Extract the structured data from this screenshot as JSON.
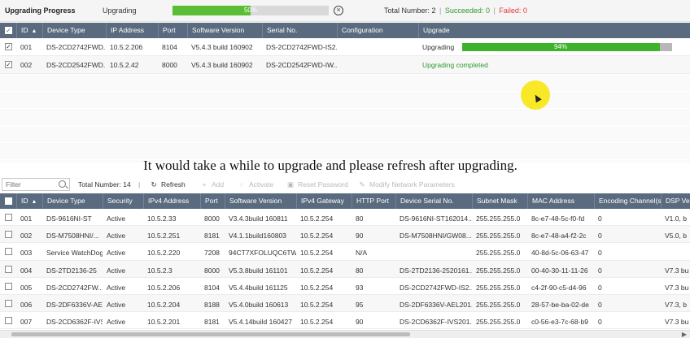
{
  "upgrade_progress": {
    "title": "Upgrading Progress",
    "status": "Upgrading",
    "percent": 50,
    "percent_label": "50%",
    "total_label": "Total Number: 2",
    "succeeded_label": "Succeeded: 0",
    "failed_label": "Failed: 0",
    "cancel_icon": "close-circle-icon"
  },
  "upgrade_table": {
    "headers": [
      "ID",
      "Device Type",
      "IP Address",
      "Port",
      "Software Version",
      "Serial No.",
      "Configuration",
      "Upgrade"
    ],
    "rows": [
      {
        "id": "001",
        "device_type": "DS-2CD2742FWD...",
        "ip": "10.5.2.206",
        "port": "8104",
        "software": "V5.4.3 build 160902",
        "serial": "DS-2CD2742FWD-IS2...",
        "configuration": "",
        "upgrade_status": "Upgrading",
        "upgrade_percent": 94,
        "upgrade_label": "94%"
      },
      {
        "id": "002",
        "device_type": "DS-2CD2542FWD...",
        "ip": "10.5.2.42",
        "port": "8000",
        "software": "V5.4.3 build 160902",
        "serial": "DS-2CD2542FWD-IW...",
        "configuration": "",
        "upgrade_status": "Upgrading completed"
      }
    ]
  },
  "notice": "It would take a while to upgrade and please refresh after upgrading.",
  "toolbar": {
    "filter_placeholder": "Filter",
    "total": "Total Number: 14",
    "refresh": "Refresh",
    "add": "Add",
    "activate": "Activate",
    "reset_password": "Reset Password",
    "modify_network": "Modify Network Parameters"
  },
  "device_table": {
    "headers": [
      "ID",
      "Device Type",
      "Security",
      "IPv4 Address",
      "Port",
      "Software Version",
      "IPv4 Gateway",
      "HTTP Port",
      "Device Serial No.",
      "Subnet Mask",
      "MAC Address",
      "Encoding Channel(s)",
      "DSP Ve"
    ],
    "rows": [
      {
        "id": "001",
        "device_type": "DS-9616NI-ST",
        "security": "Active",
        "ipv4": "10.5.2.33",
        "port": "8000",
        "software": "V3.4.3build 160811",
        "gateway": "10.5.2.254",
        "http_port": "80",
        "serial": "DS-9616NI-ST162014...",
        "subnet": "255.255.255.0",
        "mac": "8c-e7-48-5c-f0-fd",
        "channels": "0",
        "dsp": "V1.0, b"
      },
      {
        "id": "002",
        "device_type": "DS-M7508HNI/...",
        "security": "Active",
        "ipv4": "10.5.2.251",
        "port": "8181",
        "software": "V4.1.1build160803",
        "gateway": "10.5.2.254",
        "http_port": "90",
        "serial": "DS-M7508HNI/GW08...",
        "subnet": "255.255.255.0",
        "mac": "8c-e7-48-a4-f2-2c",
        "channels": "0",
        "dsp": "V5.0, b"
      },
      {
        "id": "003",
        "device_type": "Service WatchDog",
        "security": "Active",
        "ipv4": "10.5.2.220",
        "port": "7208",
        "software": "94CT7XFOLUQC6TW",
        "gateway": "10.5.2.254",
        "http_port": "N/A",
        "serial": "",
        "subnet": "255.255.255.0",
        "mac": "40-8d-5c-06-63-47",
        "channels": "0",
        "dsp": ""
      },
      {
        "id": "004",
        "device_type": "DS-2TD2136-25",
        "security": "Active",
        "ipv4": "10.5.2.3",
        "port": "8000",
        "software": "V5.3.8build 161101",
        "gateway": "10.5.2.254",
        "http_port": "80",
        "serial": "DS-2TD2136-2520161...",
        "subnet": "255.255.255.0",
        "mac": "00-40-30-11-11-26",
        "channels": "0",
        "dsp": "V7.3 bu"
      },
      {
        "id": "005",
        "device_type": "DS-2CD2742FW...",
        "security": "Active",
        "ipv4": "10.5.2.206",
        "port": "8104",
        "software": "V5.4.4build 161125",
        "gateway": "10.5.2.254",
        "http_port": "93",
        "serial": "DS-2CD2742FWD-IS2...",
        "subnet": "255.255.255.0",
        "mac": "c4-2f-90-c5-d4-96",
        "channels": "0",
        "dsp": "V7.3 bu"
      },
      {
        "id": "006",
        "device_type": "DS-2DF6336V-AEL",
        "security": "Active",
        "ipv4": "10.5.2.204",
        "port": "8188",
        "software": "V5.4.0build 160613",
        "gateway": "10.5.2.254",
        "http_port": "95",
        "serial": "DS-2DF6336V-AEL201...",
        "subnet": "255.255.255.0",
        "mac": "28-57-be-ba-02-de",
        "channels": "0",
        "dsp": "V7.3, b"
      },
      {
        "id": "007",
        "device_type": "DS-2CD6362F-IVS",
        "security": "Active",
        "ipv4": "10.5.2.201",
        "port": "8181",
        "software": "V5.4.14build 160427",
        "gateway": "10.5.2.254",
        "http_port": "90",
        "serial": "DS-2CD6362F-IVS201...",
        "subnet": "255.255.255.0",
        "mac": "c0-56-e3-7c-68-b9",
        "channels": "0",
        "dsp": "V7.3 bu"
      }
    ]
  }
}
